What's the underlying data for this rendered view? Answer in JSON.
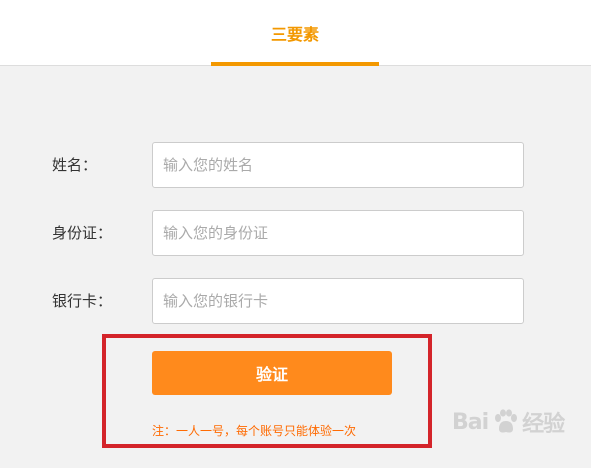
{
  "header": {
    "tab_label": "三要素"
  },
  "form": {
    "name": {
      "label": "姓名：",
      "placeholder": "输入您的姓名",
      "value": ""
    },
    "id_card": {
      "label": "身份证：",
      "placeholder": "输入您的身份证",
      "value": ""
    },
    "bank_card": {
      "label": "银行卡：",
      "placeholder": "输入您的银行卡",
      "value": ""
    }
  },
  "actions": {
    "verify_label": "验证"
  },
  "notice": "注：一人一号，每个账号只能体验一次",
  "watermark": {
    "text_left": "Bai",
    "text_right": "经验"
  },
  "colors": {
    "accent": "#f39800",
    "button": "#ff8a1c",
    "notice": "#ff6a00",
    "highlight": "#d4242a"
  },
  "icons": {
    "watermark": "baidu-paw-icon"
  }
}
